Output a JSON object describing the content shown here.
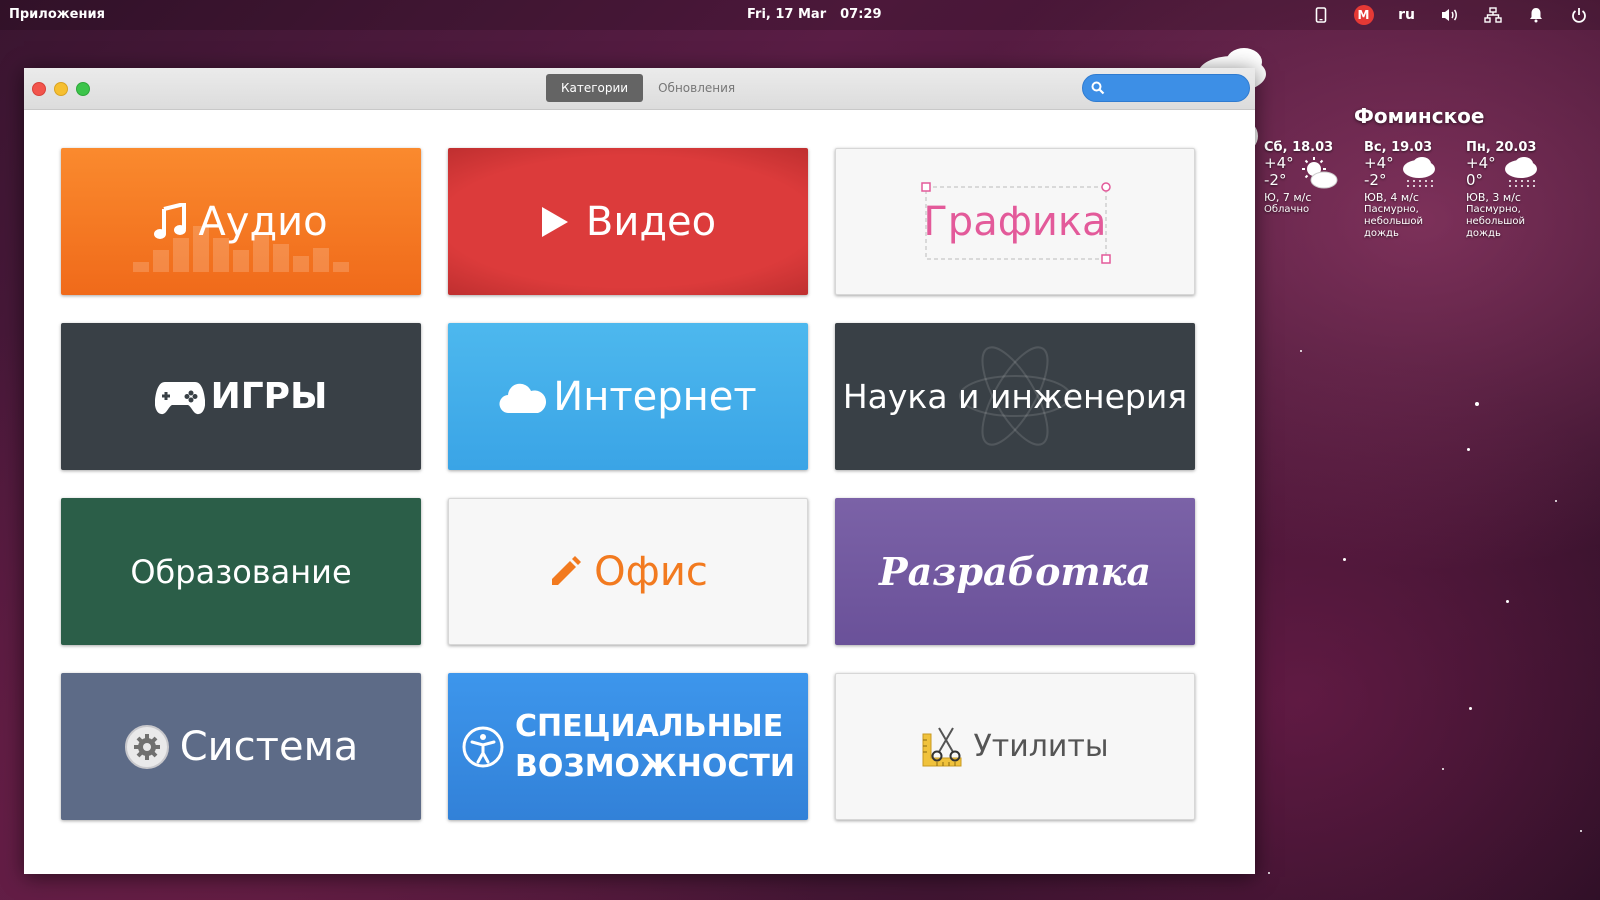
{
  "panel": {
    "apps_label": "Приложения",
    "date": "Fri, 17 Mar",
    "time": "07:29",
    "lang": "ru",
    "mail_letter": "M"
  },
  "window": {
    "tabs": [
      {
        "label": "Категории",
        "active": true
      },
      {
        "label": "Обновления",
        "active": false
      }
    ],
    "search": {
      "value": "",
      "placeholder": ""
    }
  },
  "categories": [
    {
      "label": "Аудио",
      "icon": "music-note-icon"
    },
    {
      "label": "Видео",
      "icon": "play-icon"
    },
    {
      "label": "Графика",
      "icon": "selection-frame-icon"
    },
    {
      "label": "ИГРЫ",
      "icon": "gamepad-icon"
    },
    {
      "label": "Интернет",
      "icon": "cloud-icon"
    },
    {
      "label": "Наука и инженерия",
      "icon": "atom-icon"
    },
    {
      "label": "Образование",
      "icon": ""
    },
    {
      "label": "Офис",
      "icon": "pencil-icon"
    },
    {
      "label": "Разработка",
      "icon": ""
    },
    {
      "label": "Система",
      "icon": "gear-disc-icon"
    },
    {
      "label": "СПЕЦИАЛЬНЫЕ",
      "label2": "ВОЗМОЖНОСТИ",
      "icon": "accessibility-icon"
    },
    {
      "label": "Утилиты",
      "icon": "ruler-scissors-icon"
    }
  ],
  "weather": {
    "city": "Фоминское",
    "days": [
      {
        "name": "Сб, 18.03",
        "high": "+4°",
        "low": "-2°",
        "wind": "Ю, 7 м/с",
        "cond1": "Облачно",
        "cond2": "",
        "cond3": "",
        "icon": "partly-cloudy-icon"
      },
      {
        "name": "Вс, 19.03",
        "high": "+4°",
        "low": "-2°",
        "wind": "ЮВ, 4 м/с",
        "cond1": "Пасмурно,",
        "cond2": "небольшой",
        "cond3": "дождь",
        "icon": "rain-cloud-icon"
      },
      {
        "name": "Пн, 20.03",
        "high": "+4°",
        "low": "0°",
        "wind": "ЮВ, 3 м/с",
        "cond1": "Пасмурно,",
        "cond2": "небольшой",
        "cond3": "дождь",
        "icon": "rain-cloud-icon"
      }
    ]
  },
  "colors": {
    "audio": "#f47b23",
    "video": "#d23a3a",
    "graphics_text": "#e35a9a",
    "games": "#394046",
    "internet": "#43aeea",
    "science": "#394046",
    "education": "#2b5e48",
    "office_text": "#f27a1f",
    "development": "#7259a0",
    "system": "#5d6b87",
    "accessibility": "#388bdf",
    "search_accent": "#3d8fe6"
  }
}
